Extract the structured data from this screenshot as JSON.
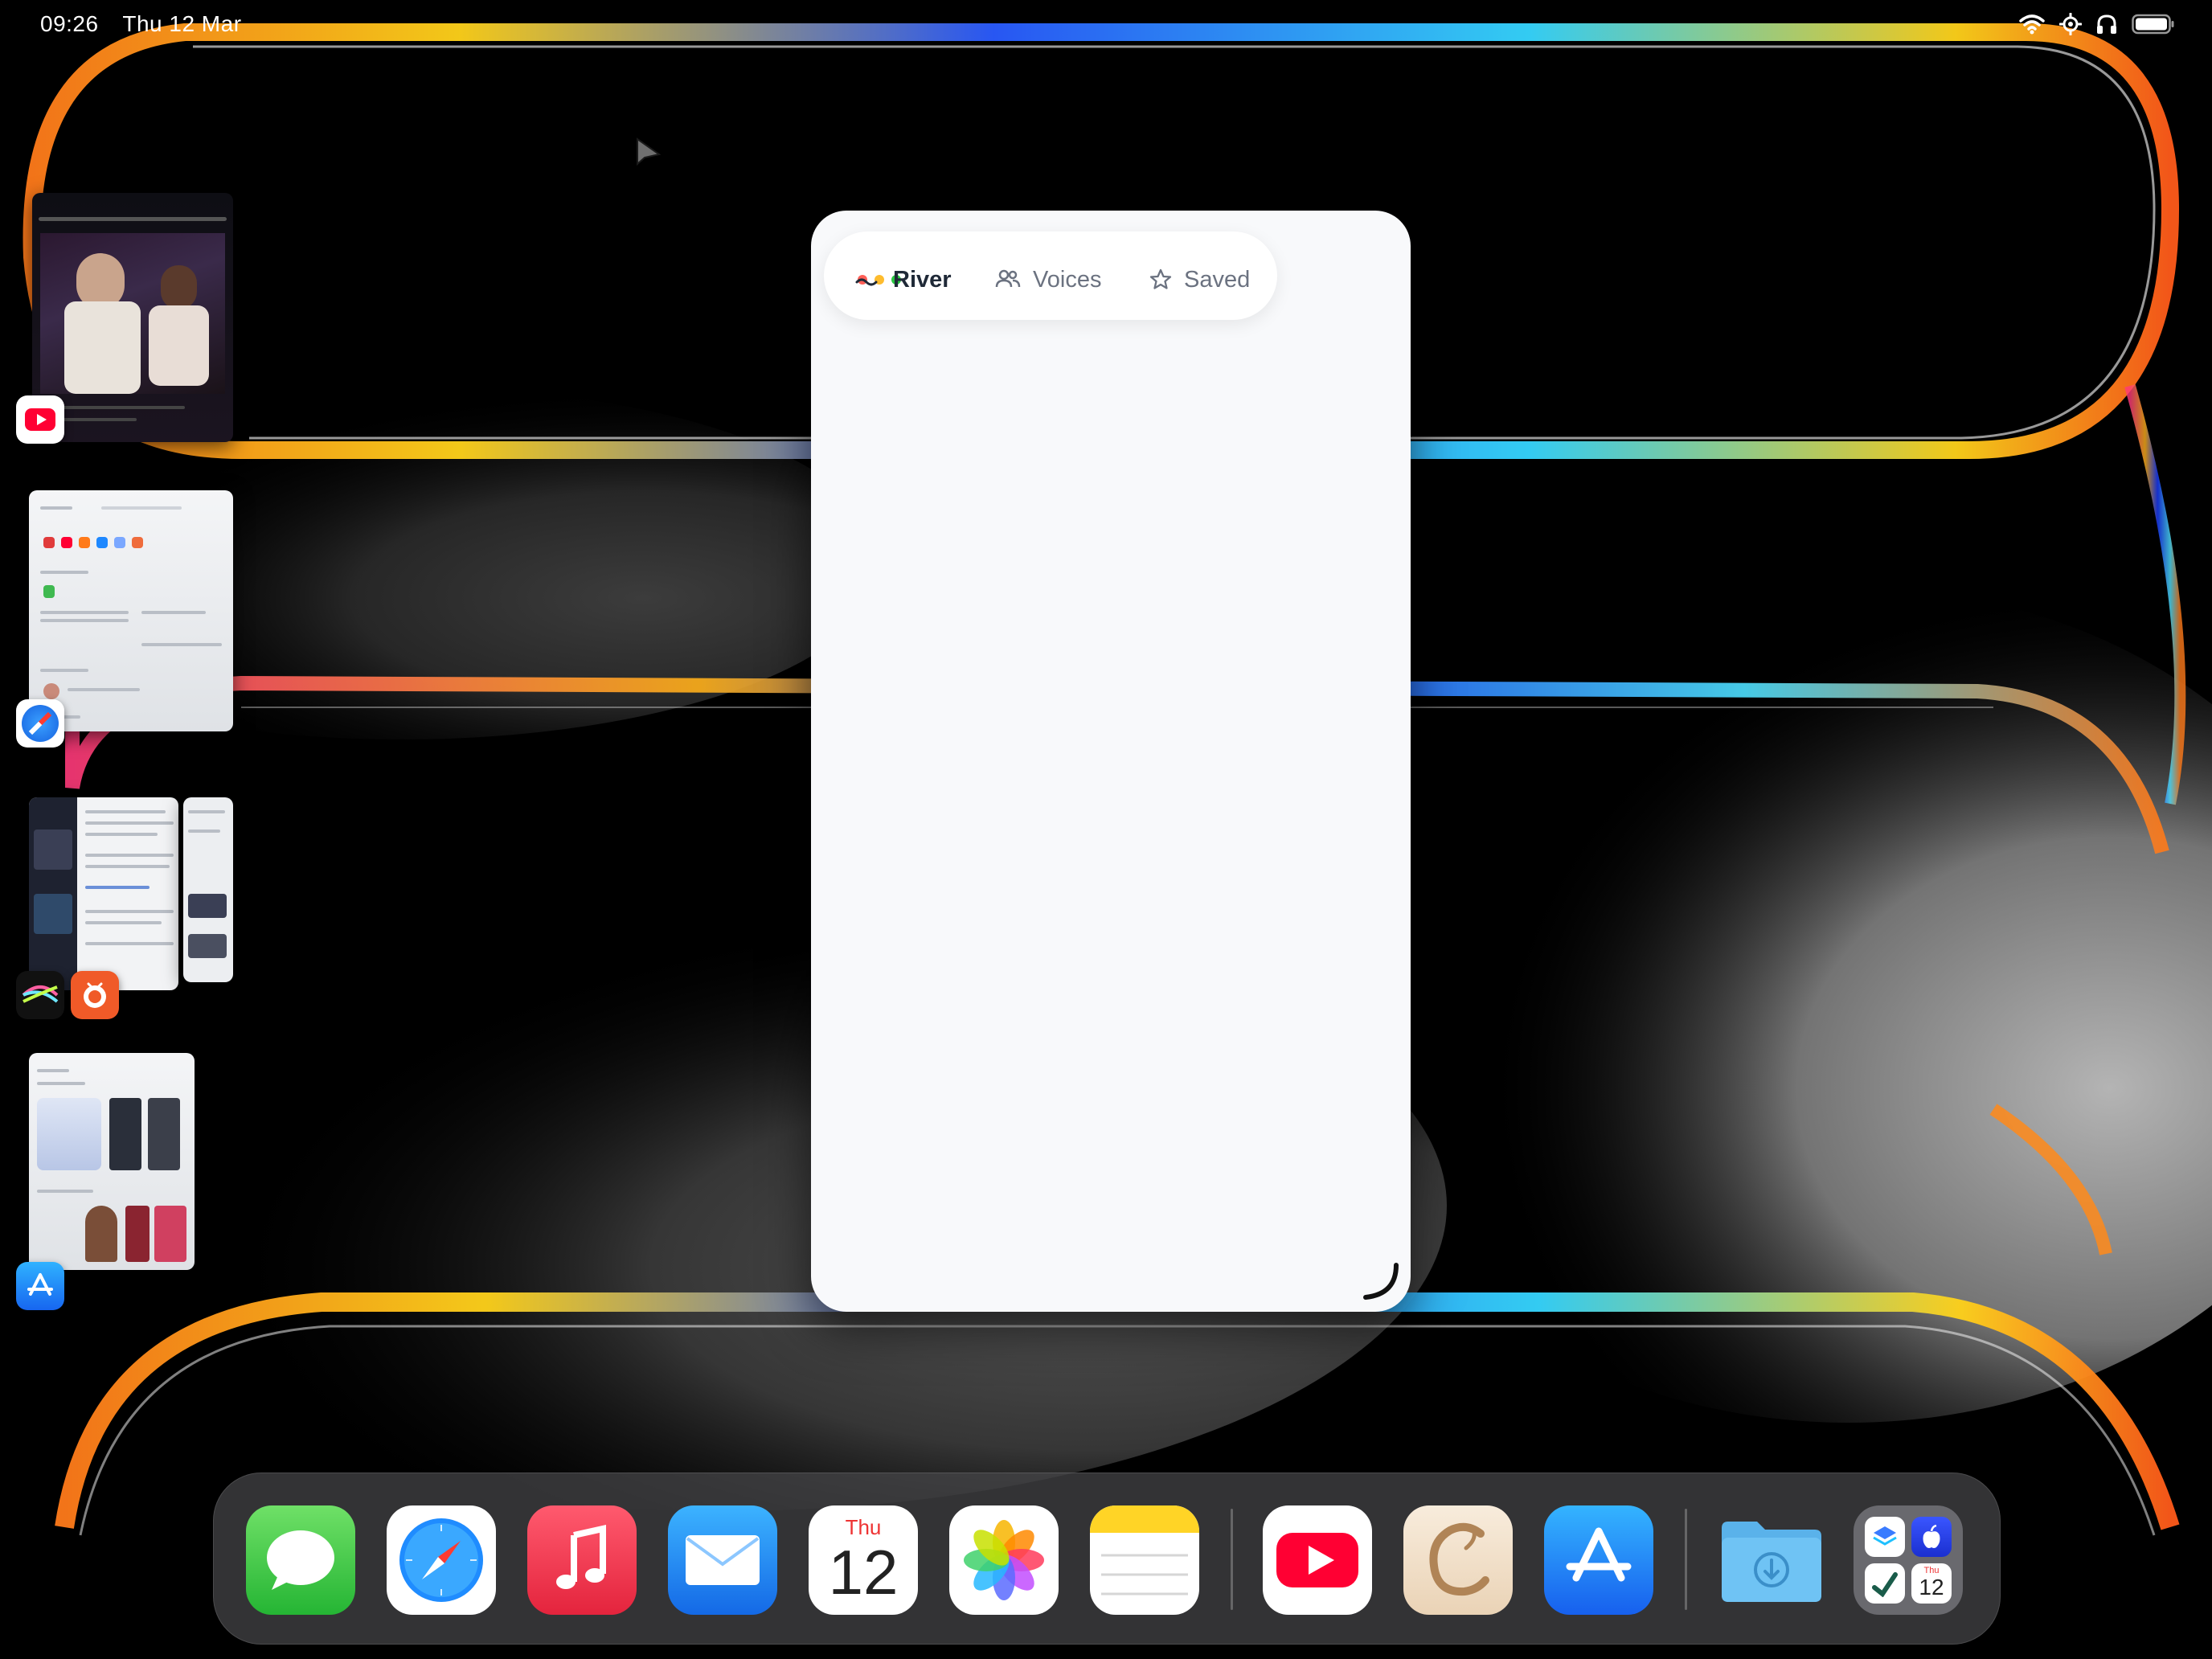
{
  "status_bar": {
    "time": "09:26",
    "date": "Thu 12 Mar",
    "icons": [
      "wifi-icon",
      "focus-icon",
      "headphones-icon",
      "battery-icon"
    ]
  },
  "stage_manager": {
    "groups": [
      {
        "name": "youtube-window",
        "apps": [
          "youtube-icon"
        ]
      },
      {
        "name": "safari-window",
        "apps": [
          "safari-icon"
        ]
      },
      {
        "name": "news-window",
        "apps": [
          "reader-app-icon",
          "news-app-icon"
        ]
      },
      {
        "name": "app-store-window",
        "apps": [
          "app-store-icon"
        ]
      }
    ]
  },
  "window": {
    "tabs": [
      {
        "label": "River",
        "icon": "river-icon",
        "active": true
      },
      {
        "label": "Voices",
        "icon": "people-icon",
        "active": false
      },
      {
        "label": "Saved",
        "icon": "star-icon",
        "active": false
      }
    ]
  },
  "dock": {
    "calendar": {
      "day": "Thu",
      "date": "12"
    },
    "mini_calendar": {
      "day": "Thu",
      "date": "12"
    },
    "apps": [
      "Messages",
      "Safari",
      "Music",
      "Mail",
      "Calendar",
      "Photos",
      "Notes",
      "YouTube",
      "Reading app",
      "App Store",
      "Downloads",
      "App Library"
    ]
  },
  "colors": {
    "accent_youtube": "#ff0033",
    "traffic_red": "#ff5f57",
    "traffic_yellow": "#febc2e",
    "traffic_green": "#28c840"
  }
}
